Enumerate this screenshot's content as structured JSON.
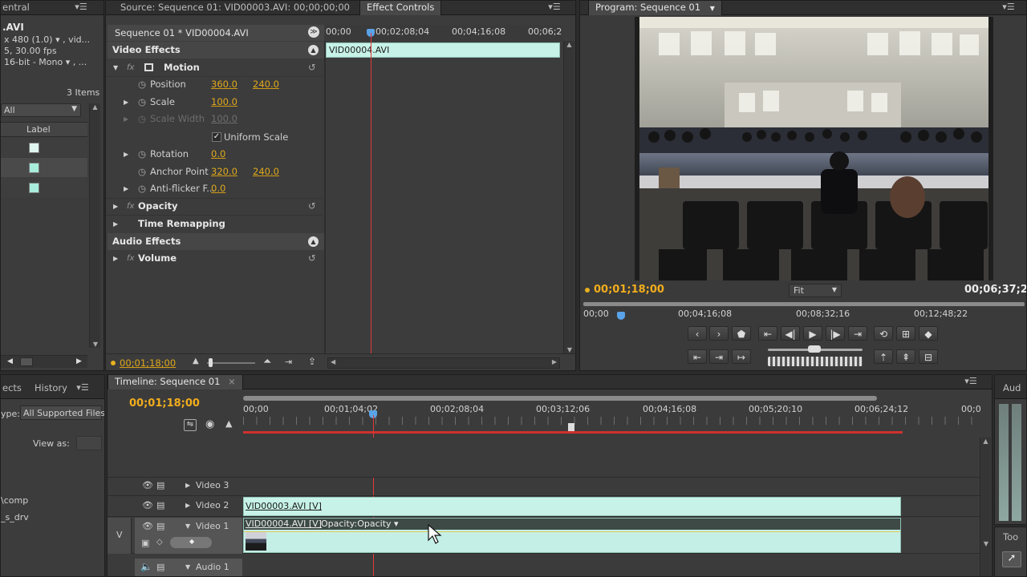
{
  "project_panel": {
    "tab_label": "entral",
    "filename": ".AVI",
    "info_lines": [
      "x 480 (1.0) ▾ , vid...",
      "5, 30.00 fps",
      "16-bit - Mono ▾ , ..."
    ],
    "items_count": "3 Items",
    "bin_dropdown": "All",
    "column_label": "Label",
    "label_colors": [
      "#dff6ef",
      "#a8ecdc",
      "#a8ecdc"
    ]
  },
  "effect_controls": {
    "tabs": [
      "Source: Sequence 01: VID00003.AVI: 00;00;00;00",
      "Effect Controls"
    ],
    "clip_header": "Sequence 01 * VID00004.AVI",
    "ruler_ticks": [
      "00;00",
      "00;02;08;04",
      "00;04;16;08",
      "00;06;2"
    ],
    "clip_in_timeline": "VID00004.AVI",
    "video_effects_label": "Video Effects",
    "motion_label": "Motion",
    "position_label": "Position",
    "position_x": "360.0",
    "position_y": "240.0",
    "scale_label": "Scale",
    "scale_value": "100.0",
    "scale_width_label": "Scale Width",
    "scale_width_value": "100.0",
    "uniform_scale_label": "Uniform Scale",
    "rotation_label": "Rotation",
    "rotation_value": "0.0",
    "anchor_label": "Anchor Point",
    "anchor_x": "320.0",
    "anchor_y": "240.0",
    "antiflicker_label": "Anti-flicker F...",
    "antiflicker_value": "0.0",
    "opacity_label": "Opacity",
    "time_remapping_label": "Time Remapping",
    "audio_effects_label": "Audio Effects",
    "volume_label": "Volume",
    "current_time": "00;01;18;00"
  },
  "program_monitor": {
    "tab_label": "Program: Sequence 01",
    "current_time": "00;01;18;00",
    "zoom": "Fit",
    "duration": "00;06;37;24",
    "ruler_ticks": [
      "00;00",
      "00;04;16;08",
      "00;08;32;16",
      "00;12;48;22"
    ]
  },
  "lower_left": {
    "tabs": [
      "ects",
      "History"
    ],
    "type_label": "ype:",
    "type_value": "All Supported Files",
    "view_as_label": "View as:",
    "path_fragments": [
      "\\comp",
      "_s_drv"
    ]
  },
  "timeline": {
    "tab_label": "Timeline: Sequence 01",
    "current_time": "00;01;18;00",
    "ruler_ticks": [
      "00;00",
      "00;01;04;02",
      "00;02;08;04",
      "00;03;12;06",
      "00;04;16;08",
      "00;05;20;10",
      "00;06;24;12",
      "00;0"
    ],
    "tracks": {
      "video3": "Video 3",
      "video2": "Video 2",
      "video1": "Video 1",
      "audio1": "Audio 1",
      "target_v": "V"
    },
    "clip_video2": "VID00003.AVI [V]",
    "clip_video1": "VID00004.AVI [V]",
    "clip_video1_opacity": "Opacity:Opacity ▾"
  },
  "audio_meter": {
    "tab_label": "Aud",
    "tools_label": "Too"
  },
  "colors": {
    "accent_yellow": "#e8b020",
    "clip_teal": "#c7f2e7",
    "playhead_red": "#e23a3a"
  }
}
